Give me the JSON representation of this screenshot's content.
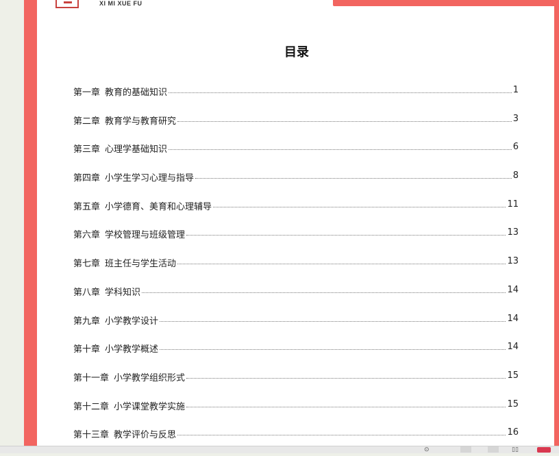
{
  "logo": {
    "text": "XI MI XUE FU"
  },
  "toc": {
    "title": "目录",
    "items": [
      {
        "chapter": "第一章",
        "name": "教育的基础知识",
        "page": "1"
      },
      {
        "chapter": "第二章",
        "name": "教育学与教育研究",
        "page": "3"
      },
      {
        "chapter": "第三章",
        "name": "心理学基础知识",
        "page": "6"
      },
      {
        "chapter": "第四章",
        "name": "小学生学习心理与指导",
        "page": "8"
      },
      {
        "chapter": "第五章",
        "name": "小学德育、美育和心理辅导",
        "page": "11"
      },
      {
        "chapter": "第六章",
        "name": "学校管理与班级管理",
        "page": "13"
      },
      {
        "chapter": "第七章",
        "name": "班主任与学生活动",
        "page": "13"
      },
      {
        "chapter": "第八章",
        "name": "学科知识",
        "page": "14"
      },
      {
        "chapter": "第九章",
        "name": "小学教学设计",
        "page": "14"
      },
      {
        "chapter": "第十章",
        "name": "小学教学概述",
        "page": "14"
      },
      {
        "chapter": "第十一章",
        "name": "小学教学组织形式",
        "page": "15"
      },
      {
        "chapter": "第十二章",
        "name": "小学课堂教学实施",
        "page": "15"
      },
      {
        "chapter": "第十三章",
        "name": "教学评价与反思",
        "page": "16"
      }
    ]
  },
  "colors": {
    "frame": "#f26560",
    "page": "#ffffff",
    "accent_red": "#d9384f"
  },
  "icons": [
    "zoom-icon",
    "single-page-icon",
    "continuous-page-icon",
    "two-page-icon",
    "app-badge-icon"
  ]
}
